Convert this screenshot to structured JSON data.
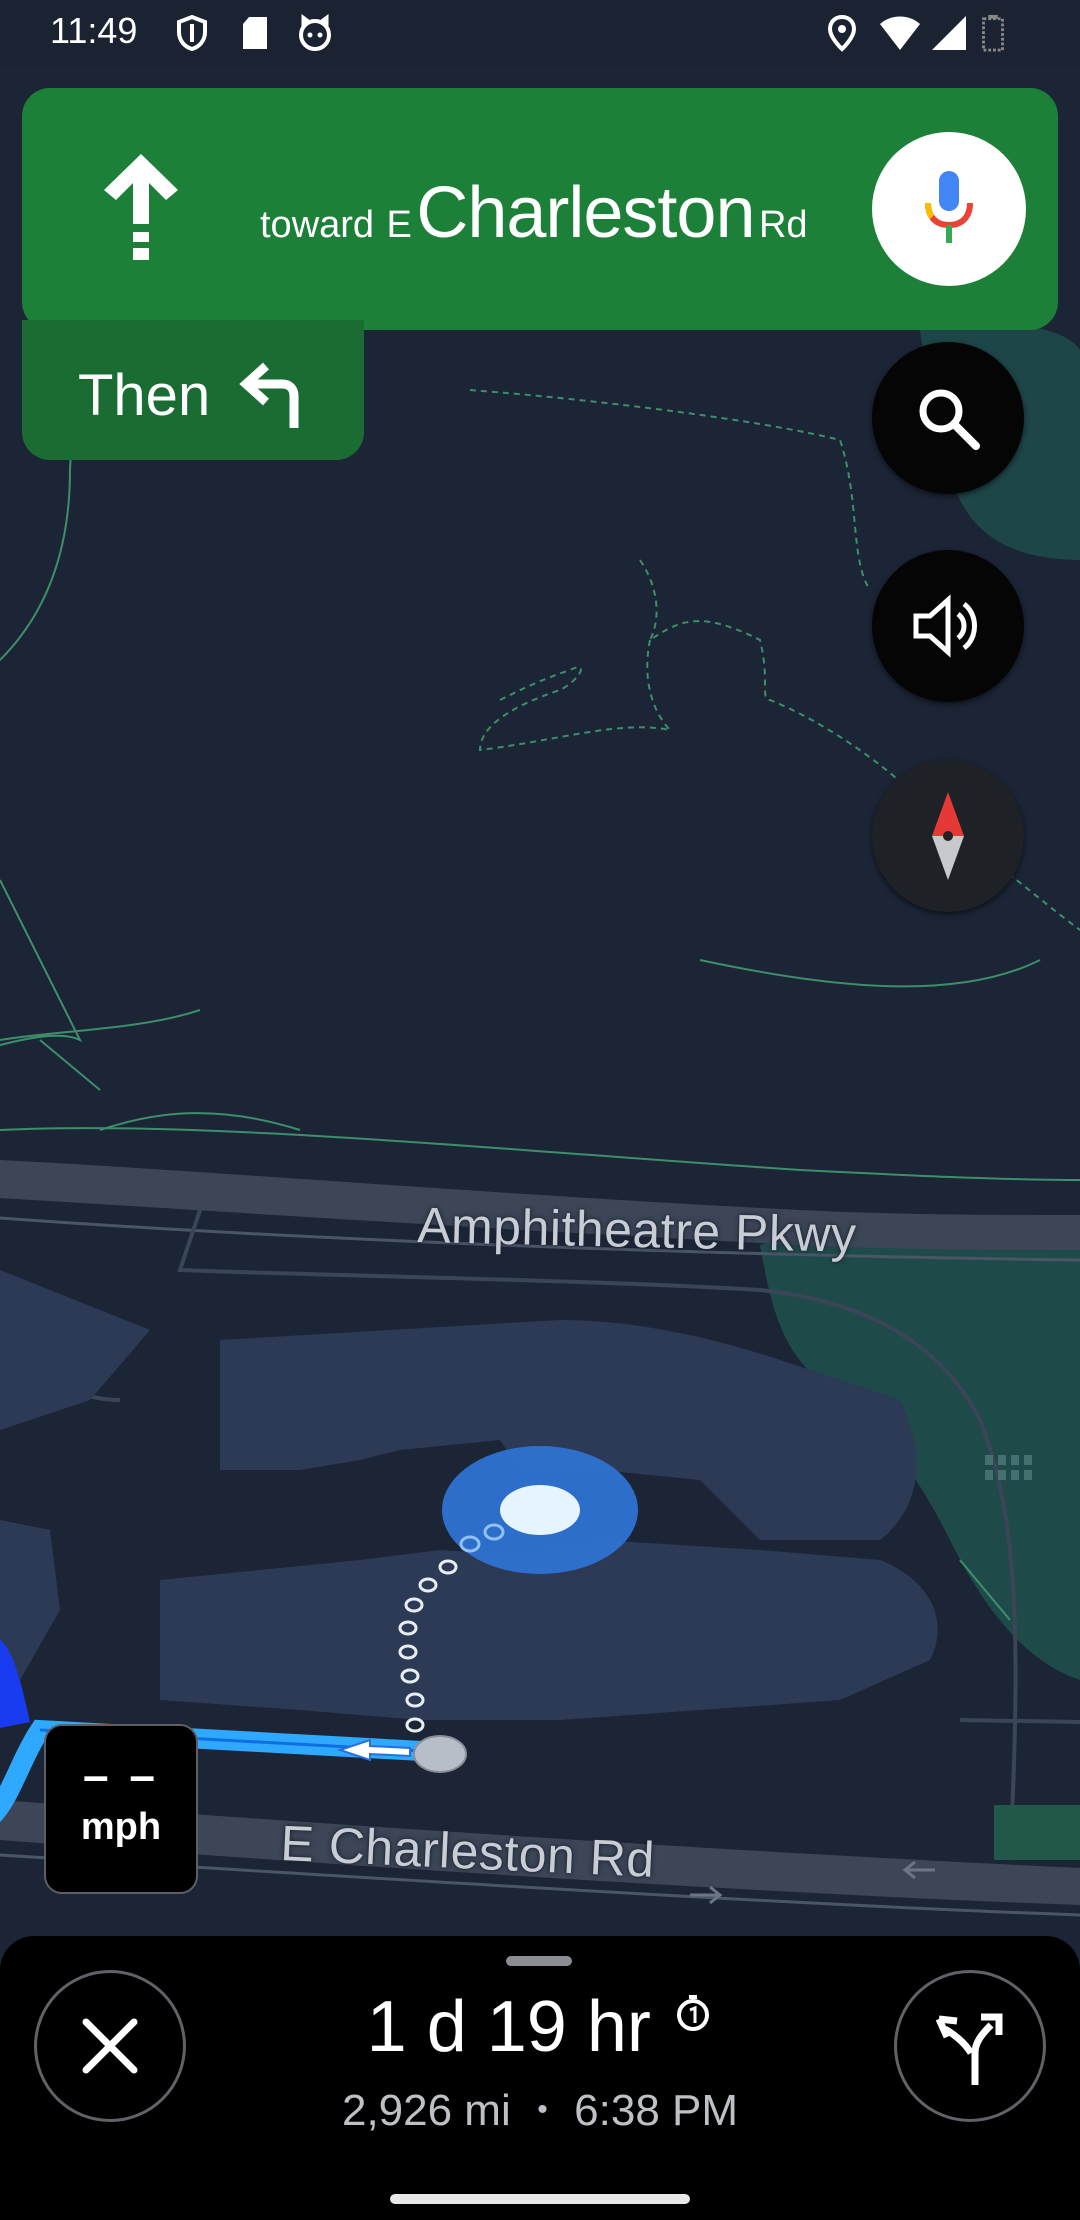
{
  "status_bar": {
    "time": "11:49",
    "left_icons": [
      "shield-icon",
      "sd-card-icon",
      "cat-face-icon"
    ],
    "right_icons": [
      "location-icon",
      "wifi-icon",
      "signal-icon",
      "battery-icon"
    ]
  },
  "navigation": {
    "instruction": {
      "direction_icon": "arrow-up-icon",
      "toward_word": "toward",
      "street_prefix": "E",
      "street_main": "Charleston",
      "street_suffix": "Rd"
    },
    "then": {
      "label": "Then",
      "direction_icon": "turn-left-icon"
    },
    "buttons": {
      "voice": "mic-icon",
      "search": "search-icon",
      "audio": "volume-icon",
      "compass": "compass-icon"
    }
  },
  "map": {
    "street_labels": [
      "Amphitheatre Pkwy",
      "E Charleston Rd"
    ]
  },
  "speed": {
    "value": "– –",
    "unit": "mph"
  },
  "trip": {
    "duration": "1 d 19 hr",
    "duration_info_icon": "timer-icon",
    "distance": "2,926 mi",
    "separator": "•",
    "arrival": "6:38 PM",
    "close_icon": "close-icon",
    "alternate_routes_icon": "route-options-icon"
  },
  "colors": {
    "banner_green": "#1d8038",
    "then_green": "#1a6c33",
    "route_blue": "#2fa8ff",
    "location_blue": "#2d72d2",
    "map_background": "#1c2536"
  }
}
